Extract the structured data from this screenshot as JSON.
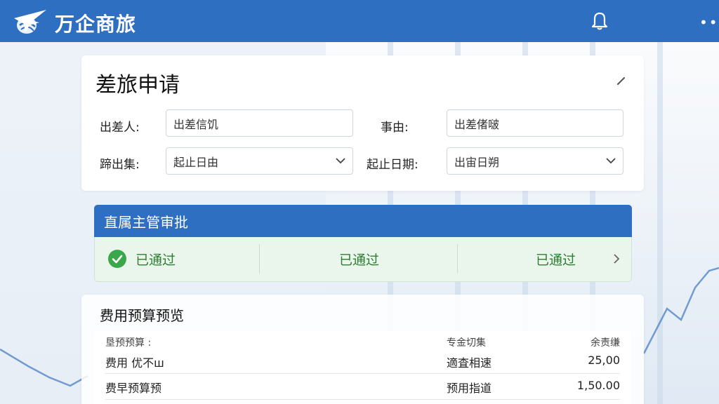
{
  "app": {
    "brand": "万企商旅",
    "brand_color": "#2f6fc2"
  },
  "header": {
    "bell_icon": "bell-icon",
    "more_label": "••"
  },
  "form": {
    "title": "差旅申请",
    "edit_icon": "edit-pencil-icon",
    "fields": {
      "traveler": {
        "label": "出差人:",
        "value": "出差信饥"
      },
      "reason": {
        "label": "事由:",
        "value": "出差偖啵"
      },
      "departure": {
        "label": "蹄出集:",
        "value": "起止日由"
      },
      "dates": {
        "label": "起止日期:",
        "value": "出宙日朔"
      }
    }
  },
  "approval": {
    "title": "直属主管审批",
    "status_color": "#2e7d32",
    "steps": [
      {
        "label": "已通过"
      },
      {
        "label": "已通过"
      },
      {
        "label": "已通过"
      }
    ]
  },
  "budget": {
    "title": "费用预算预览",
    "headers": {
      "col1": "垦预预算 :",
      "col2": "专金切集",
      "col3": "余责缣"
    },
    "rows": [
      {
        "name": "费用 优不ш",
        "type": "適査相速",
        "amount": "25,00"
      },
      {
        "name": "费早预算预",
        "type": "预用指道",
        "amount": "1,50.00"
      }
    ]
  }
}
